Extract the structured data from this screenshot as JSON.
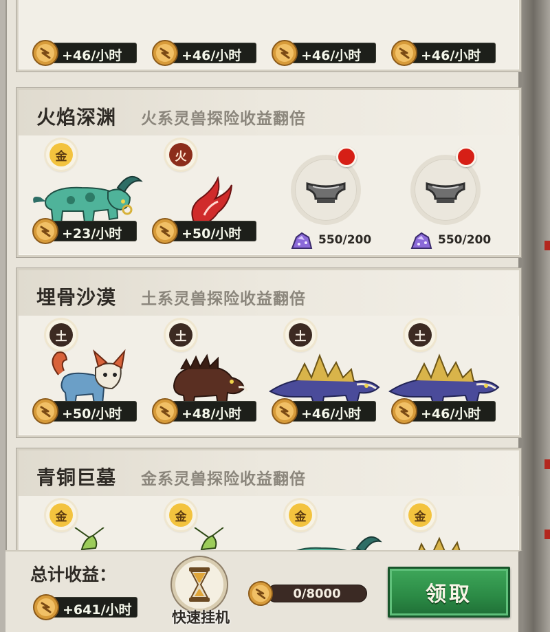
{
  "colors": {
    "panel_bg": "#e8e4da",
    "rate_bg": "#1d1f1a",
    "rate_text": "#f4f7ea",
    "claim_button": "#2b8a45",
    "notification_dot": "#d61f16"
  },
  "top_row": {
    "slots": [
      {
        "rate": "+46/小时",
        "icon": "coin-icon"
      },
      {
        "rate": "+46/小时",
        "icon": "coin-icon"
      },
      {
        "rate": "+46/小时",
        "icon": "coin-icon"
      },
      {
        "rate": "+46/小时",
        "icon": "coin-icon"
      }
    ]
  },
  "sections": [
    {
      "title": "火焰深渊",
      "description": "火系灵兽探险收益翻倍",
      "slots": [
        {
          "type": "beast",
          "element": "金",
          "creature": "bull-beast-icon",
          "rate": "+23/小时"
        },
        {
          "type": "beast",
          "element": "火",
          "creature": "fire-bird-icon",
          "rate": "+50/小时"
        },
        {
          "type": "empty",
          "icon": "empty-slot-icon",
          "cost": "550/200",
          "has_notice": true
        },
        {
          "type": "empty",
          "icon": "empty-slot-icon",
          "cost": "550/200",
          "has_notice": true
        }
      ]
    },
    {
      "title": "埋骨沙漠",
      "description": "土系灵兽探险收益翻倍",
      "slots": [
        {
          "type": "beast",
          "element": "土",
          "creature": "lynx-beast-icon",
          "rate": "+50/小时"
        },
        {
          "type": "beast",
          "element": "土",
          "creature": "boar-beast-icon",
          "rate": "+48/小时"
        },
        {
          "type": "beast",
          "element": "土",
          "creature": "stegosaur-beast-icon",
          "rate": "+46/小时"
        },
        {
          "type": "beast",
          "element": "土",
          "creature": "stegosaur-beast-icon",
          "rate": "+46/小时"
        }
      ]
    },
    {
      "title": "青铜巨墓",
      "description": "金系灵兽探险收益翻倍",
      "slots": [
        {
          "type": "beast",
          "element": "金",
          "creature": "mantis-beast-icon"
        },
        {
          "type": "beast",
          "element": "金",
          "creature": "mantis-beast-icon"
        },
        {
          "type": "beast",
          "element": "金",
          "creature": "bull-beast-icon"
        },
        {
          "type": "beast",
          "element": "金",
          "creature": "spiky-beast-icon"
        }
      ]
    }
  ],
  "footer": {
    "total_label": "总计收益：",
    "total_rate": "+641/小时",
    "quick_idle_label": "快速挂机",
    "storage_text": "0/8000",
    "storage_fraction": 0,
    "claim_label": "领取"
  }
}
